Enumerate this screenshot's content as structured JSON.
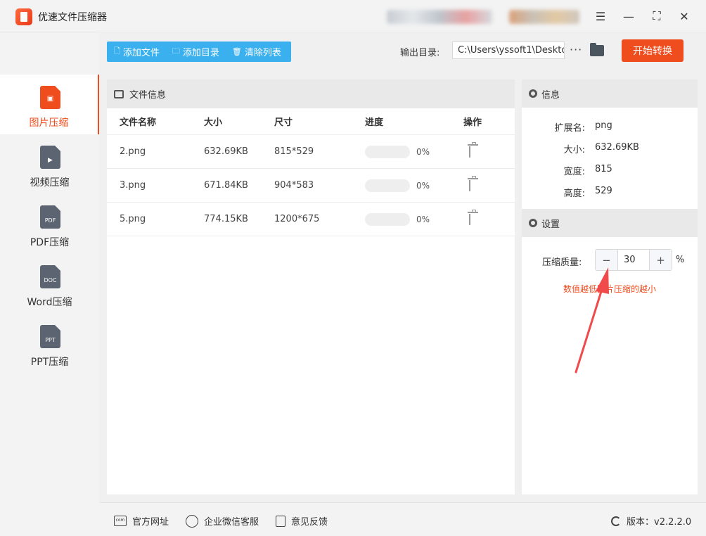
{
  "app": {
    "title": "优速文件压缩器"
  },
  "sidebar": {
    "items": [
      {
        "label": "图片压缩",
        "tag": "",
        "active": true
      },
      {
        "label": "视频压缩",
        "tag": "▶",
        "active": false
      },
      {
        "label": "PDF压缩",
        "tag": "PDF",
        "active": false
      },
      {
        "label": "Word压缩",
        "tag": "DOC",
        "active": false
      },
      {
        "label": "PPT压缩",
        "tag": "PPT",
        "active": false
      }
    ]
  },
  "toolbar": {
    "add_file": "添加文件",
    "add_dir": "添加目录",
    "clear_list": "清除列表",
    "output_label": "输出目录:",
    "output_path": "C:\\Users\\yssoft1\\Desktop",
    "more": "···",
    "start": "开始转换"
  },
  "files": {
    "title": "文件信息",
    "columns": [
      "文件名称",
      "大小",
      "尺寸",
      "进度",
      "操作"
    ],
    "rows": [
      {
        "name": "2.png",
        "size": "632.69KB",
        "dim": "815*529",
        "progress": "0%",
        "progress_value": 0
      },
      {
        "name": "3.png",
        "size": "671.84KB",
        "dim": "904*583",
        "progress": "0%",
        "progress_value": 0
      },
      {
        "name": "5.png",
        "size": "774.15KB",
        "dim": "1200*675",
        "progress": "0%",
        "progress_value": 0
      }
    ]
  },
  "info": {
    "title": "信息",
    "ext_label": "扩展名:",
    "ext": "png",
    "size_label": "大小:",
    "size": "632.69KB",
    "width_label": "宽度:",
    "width": "815",
    "height_label": "高度:",
    "height": "529"
  },
  "settings": {
    "title": "设置",
    "quality_label": "压缩质量:",
    "quality": "30",
    "minus": "−",
    "plus": "+",
    "unit": "%",
    "hint": "数值越低图片压缩的越小"
  },
  "footer": {
    "website": "官方网址",
    "wechat": "企业微信客服",
    "feedback": "意见反馈",
    "version": "版本：v2.2.2.0"
  },
  "colors": {
    "accent": "#f04d1e",
    "toolbar_blue": "#3ab0ef",
    "arrow": "#f04a4a"
  }
}
